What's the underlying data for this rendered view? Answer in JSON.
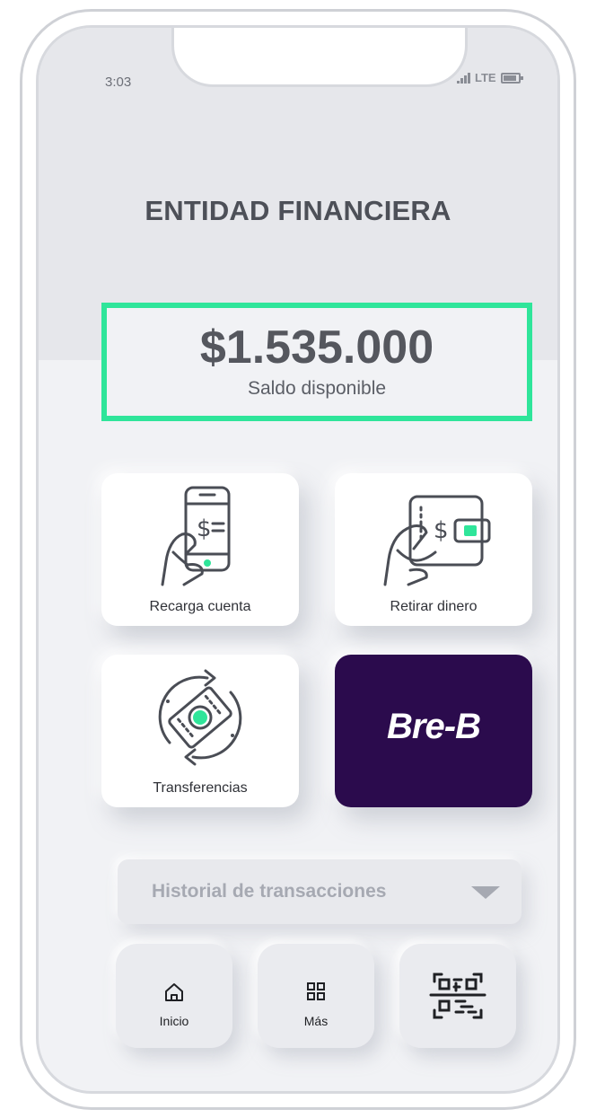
{
  "status_bar": {
    "time": "3:03",
    "network": "LTE",
    "battery": "55"
  },
  "header": {
    "title": "ENTIDAD FINANCIERA"
  },
  "balance": {
    "amount": "$1.535.000",
    "label": "Saldo disponible"
  },
  "actions": {
    "recarga_label": "Recarga cuenta",
    "retirar_label": "Retirar dinero",
    "transfer_label": "Transferencias",
    "breb_logo": "Bre-B"
  },
  "history": {
    "label": "Historial de transacciones"
  },
  "nav": {
    "inicio_label": "Inicio",
    "mas_label": "Más"
  },
  "colors": {
    "accent_green": "#2fe59a",
    "breb_purple": "#2b0b4d",
    "screen_bg": "#f1f2f5"
  },
  "icons": [
    "signal-icon",
    "battery-icon",
    "phone-dollar-icon",
    "wallet-dollar-icon",
    "transfer-cycle-icon",
    "home-icon",
    "grid-icon",
    "qr-code-icon",
    "caret-down-icon"
  ]
}
